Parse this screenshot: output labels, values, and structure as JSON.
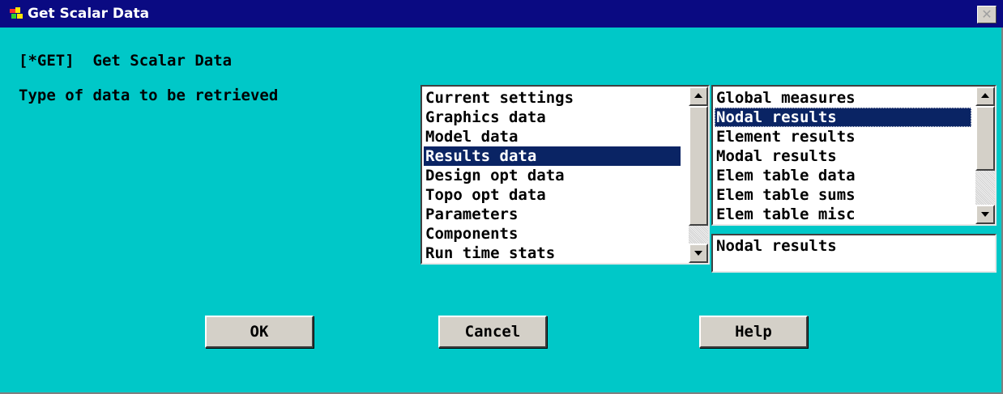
{
  "window": {
    "title": "Get Scalar Data",
    "close_glyph": "✕"
  },
  "header": {
    "command": "[*GET]  Get Scalar Data"
  },
  "form": {
    "type_label": "Type of data to be retrieved",
    "category_list": {
      "items": [
        "Current settings",
        "Graphics data",
        "Model data",
        "Results data",
        "Design opt data",
        "Topo opt data",
        "Parameters",
        "Components",
        "Run time stats"
      ],
      "selected": "Results data"
    },
    "subtype_list": {
      "items": [
        "Global measures",
        "Nodal results",
        "Element results",
        "Modal results",
        "Elem table data",
        "Elem table sums",
        "Elem table misc"
      ],
      "selected": "Nodal results"
    },
    "selection_value": "Nodal results"
  },
  "buttons": {
    "ok": "OK",
    "cancel": "Cancel",
    "help": "Help"
  },
  "colors": {
    "dialog_background": "#00c8c8",
    "titlebar": "#0a0a82",
    "selection": "#0a2464",
    "button_face": "#d4d0c8"
  },
  "icons": {
    "app": "ansys-app-icon",
    "close": "close-icon",
    "scroll_up": "scroll-up-arrow-icon",
    "scroll_down": "scroll-down-arrow-icon"
  }
}
